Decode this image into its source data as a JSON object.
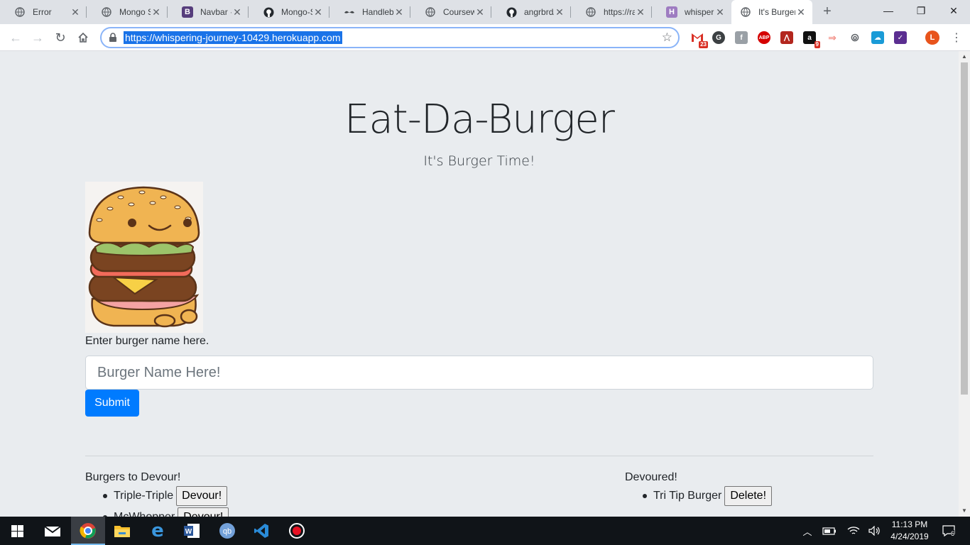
{
  "browser": {
    "tabs": [
      {
        "title": "Error",
        "icon": "globe-icon"
      },
      {
        "title": "Mongo S",
        "icon": "globe-icon"
      },
      {
        "title": "Navbar · B",
        "icon": "bootstrap-icon"
      },
      {
        "title": "Mongo-S",
        "icon": "github-icon"
      },
      {
        "title": "Handlebars",
        "icon": "mustache-icon"
      },
      {
        "title": "Coursework",
        "icon": "globe-icon"
      },
      {
        "title": "angrbrd/",
        "icon": "github-icon"
      },
      {
        "title": "https://ra",
        "icon": "globe-icon"
      },
      {
        "title": "whispering",
        "icon": "heroku-icon"
      },
      {
        "title": "It's Burger",
        "icon": "globe-icon"
      }
    ],
    "url": "https://whispering-journey-10429.herokuapp.com",
    "extensions": [
      {
        "name": "gmail-extension-icon",
        "badge": "23",
        "color": "#d93025"
      },
      {
        "name": "grammarly-extension-icon",
        "badge": "",
        "color": "#3c4043"
      },
      {
        "name": "extension-gray-icon",
        "badge": "",
        "color": "#9aa0a6"
      },
      {
        "name": "adblock-extension-icon",
        "badge": "",
        "color": "#d50000"
      },
      {
        "name": "pdf-extension-icon",
        "badge": "",
        "color": "#b3261e"
      },
      {
        "name": "amazon-extension-icon",
        "badge": "9",
        "color": "#111111"
      },
      {
        "name": "cast-extension-icon",
        "badge": "",
        "color": "#f28b82"
      },
      {
        "name": "code-extension-icon",
        "badge": "",
        "color": "#5f6368"
      },
      {
        "name": "cloud-extension-icon",
        "badge": "",
        "color": "#1a9bd7"
      },
      {
        "name": "check-extension-icon",
        "badge": "",
        "color": "#5b2e91"
      }
    ],
    "profile_initial": "L"
  },
  "page": {
    "title": "Eat-Da-Burger",
    "subtitle": "It's Burger Time!",
    "form": {
      "label": "Enter burger name here.",
      "placeholder": "Burger Name Here!",
      "submit_label": "Submit"
    },
    "to_devour": {
      "heading": "Burgers to Devour!",
      "items": [
        {
          "name": "Triple-Triple",
          "button": "Devour!"
        },
        {
          "name": "McWhopper",
          "button": "Devour!"
        }
      ]
    },
    "devoured": {
      "heading": "Devoured!",
      "items": [
        {
          "name": "Tri Tip Burger",
          "button": "Delete!"
        }
      ]
    }
  },
  "taskbar": {
    "time": "11:13 PM",
    "date": "4/24/2019",
    "notification_count": "6"
  },
  "colors": {
    "accent": "#007bff",
    "page_bg": "#e9ecef"
  }
}
